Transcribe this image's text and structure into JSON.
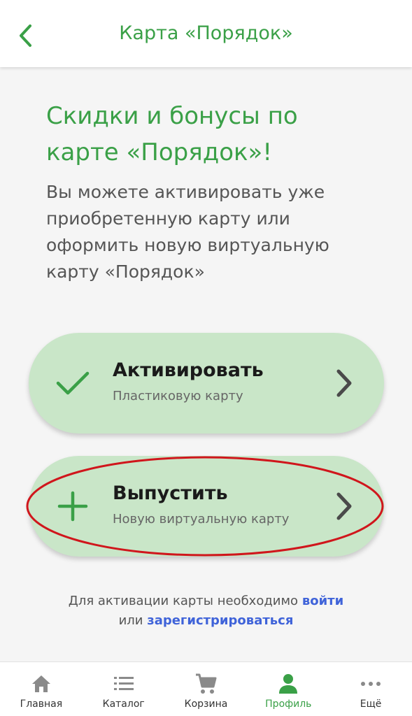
{
  "header": {
    "title": "Карта «Порядок»"
  },
  "main": {
    "headline": "Скидки и бонусы по карте «Порядок»!",
    "description": "Вы можете активировать уже приобретенную карту или оформить новую виртуальную карту «Порядок»"
  },
  "actions": [
    {
      "title": "Активировать",
      "subtitle": "Пластиковую карту",
      "icon": "check-icon"
    },
    {
      "title": "Выпустить",
      "subtitle": "Новую виртуальную карту",
      "icon": "plus-icon"
    }
  ],
  "note": {
    "prefix": "Для активации карты необходимо",
    "login": "войти",
    "middle": "или",
    "register": "зарегистрироваться"
  },
  "tabbar": [
    {
      "label": "Главная",
      "icon": "home-icon"
    },
    {
      "label": "Каталог",
      "icon": "list-icon"
    },
    {
      "label": "Корзина",
      "icon": "cart-icon"
    },
    {
      "label": "Профиль",
      "icon": "person-icon",
      "active": true
    },
    {
      "label": "Ещё",
      "icon": "more-icon"
    }
  ],
  "colors": {
    "brand_green": "#3aa047",
    "button_bg": "#c9e6c8",
    "link_blue": "#3f63d9",
    "annotation_red": "#d0161c"
  }
}
